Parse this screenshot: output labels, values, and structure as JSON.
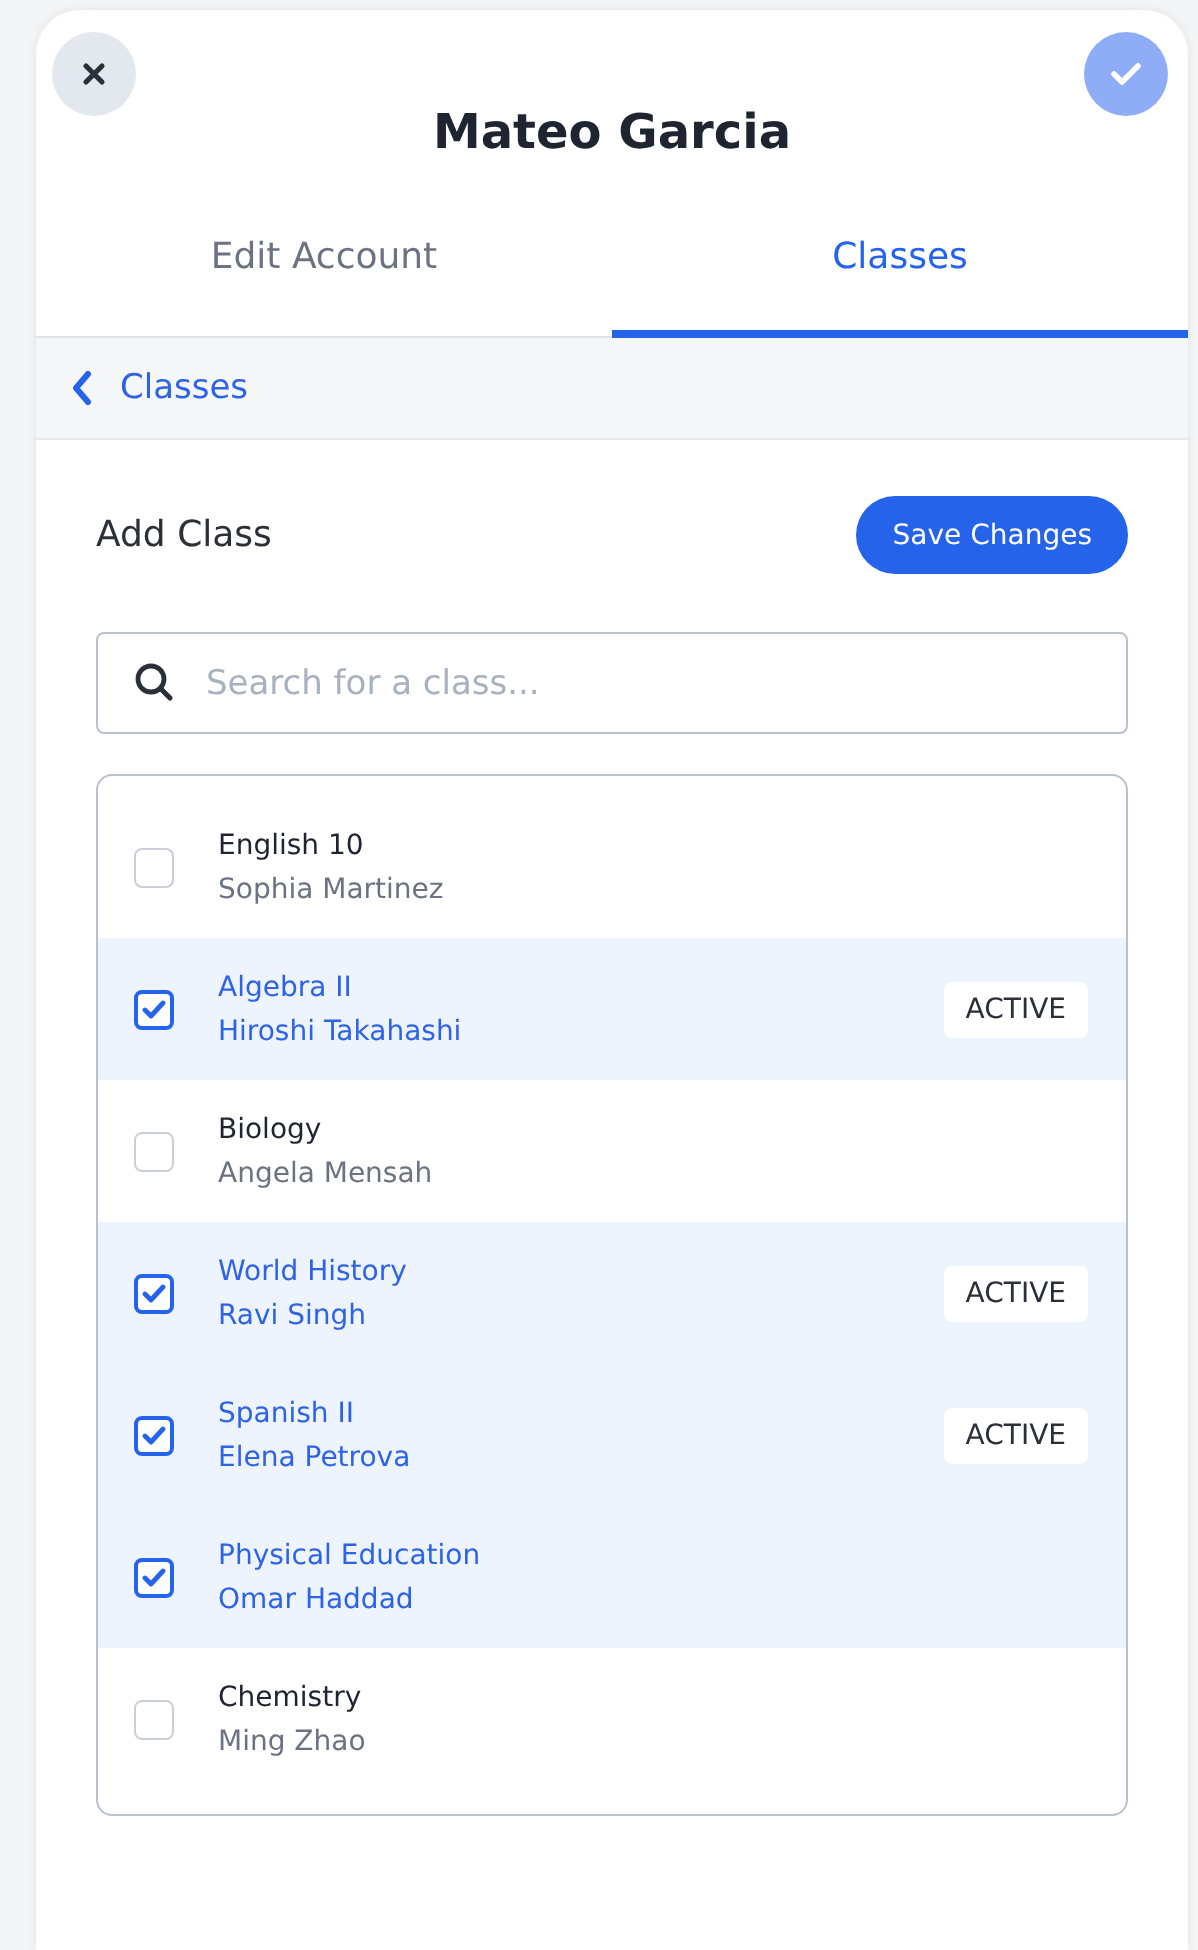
{
  "header": {
    "title": "Mateo Garcia",
    "confirm_button": {
      "disabled": true
    }
  },
  "tabs": [
    {
      "label": "Edit Account",
      "selected": false
    },
    {
      "label": "Classes",
      "selected": true
    }
  ],
  "breadcrumb": {
    "label": "Classes"
  },
  "section": {
    "title": "Add Class",
    "save_button": "Save Changes"
  },
  "search": {
    "placeholder": "Search for a class..."
  },
  "classes": [
    {
      "name": "English 10",
      "teacher": "Sophia Martinez",
      "checked": false
    },
    {
      "name": "Algebra II",
      "teacher": "Hiroshi Takahashi",
      "checked": true,
      "badge": "ACTIVE"
    },
    {
      "name": "Biology",
      "teacher": "Angela Mensah",
      "checked": false
    },
    {
      "name": "World History",
      "teacher": "Ravi Singh",
      "checked": true,
      "badge": "ACTIVE"
    },
    {
      "name": "Spanish II",
      "teacher": "Elena Petrova",
      "checked": true,
      "badge": "ACTIVE"
    },
    {
      "name": "Physical Education",
      "teacher": "Omar Haddad",
      "checked": true
    },
    {
      "name": "Chemistry",
      "teacher": "Ming Zhao",
      "checked": false
    }
  ]
}
